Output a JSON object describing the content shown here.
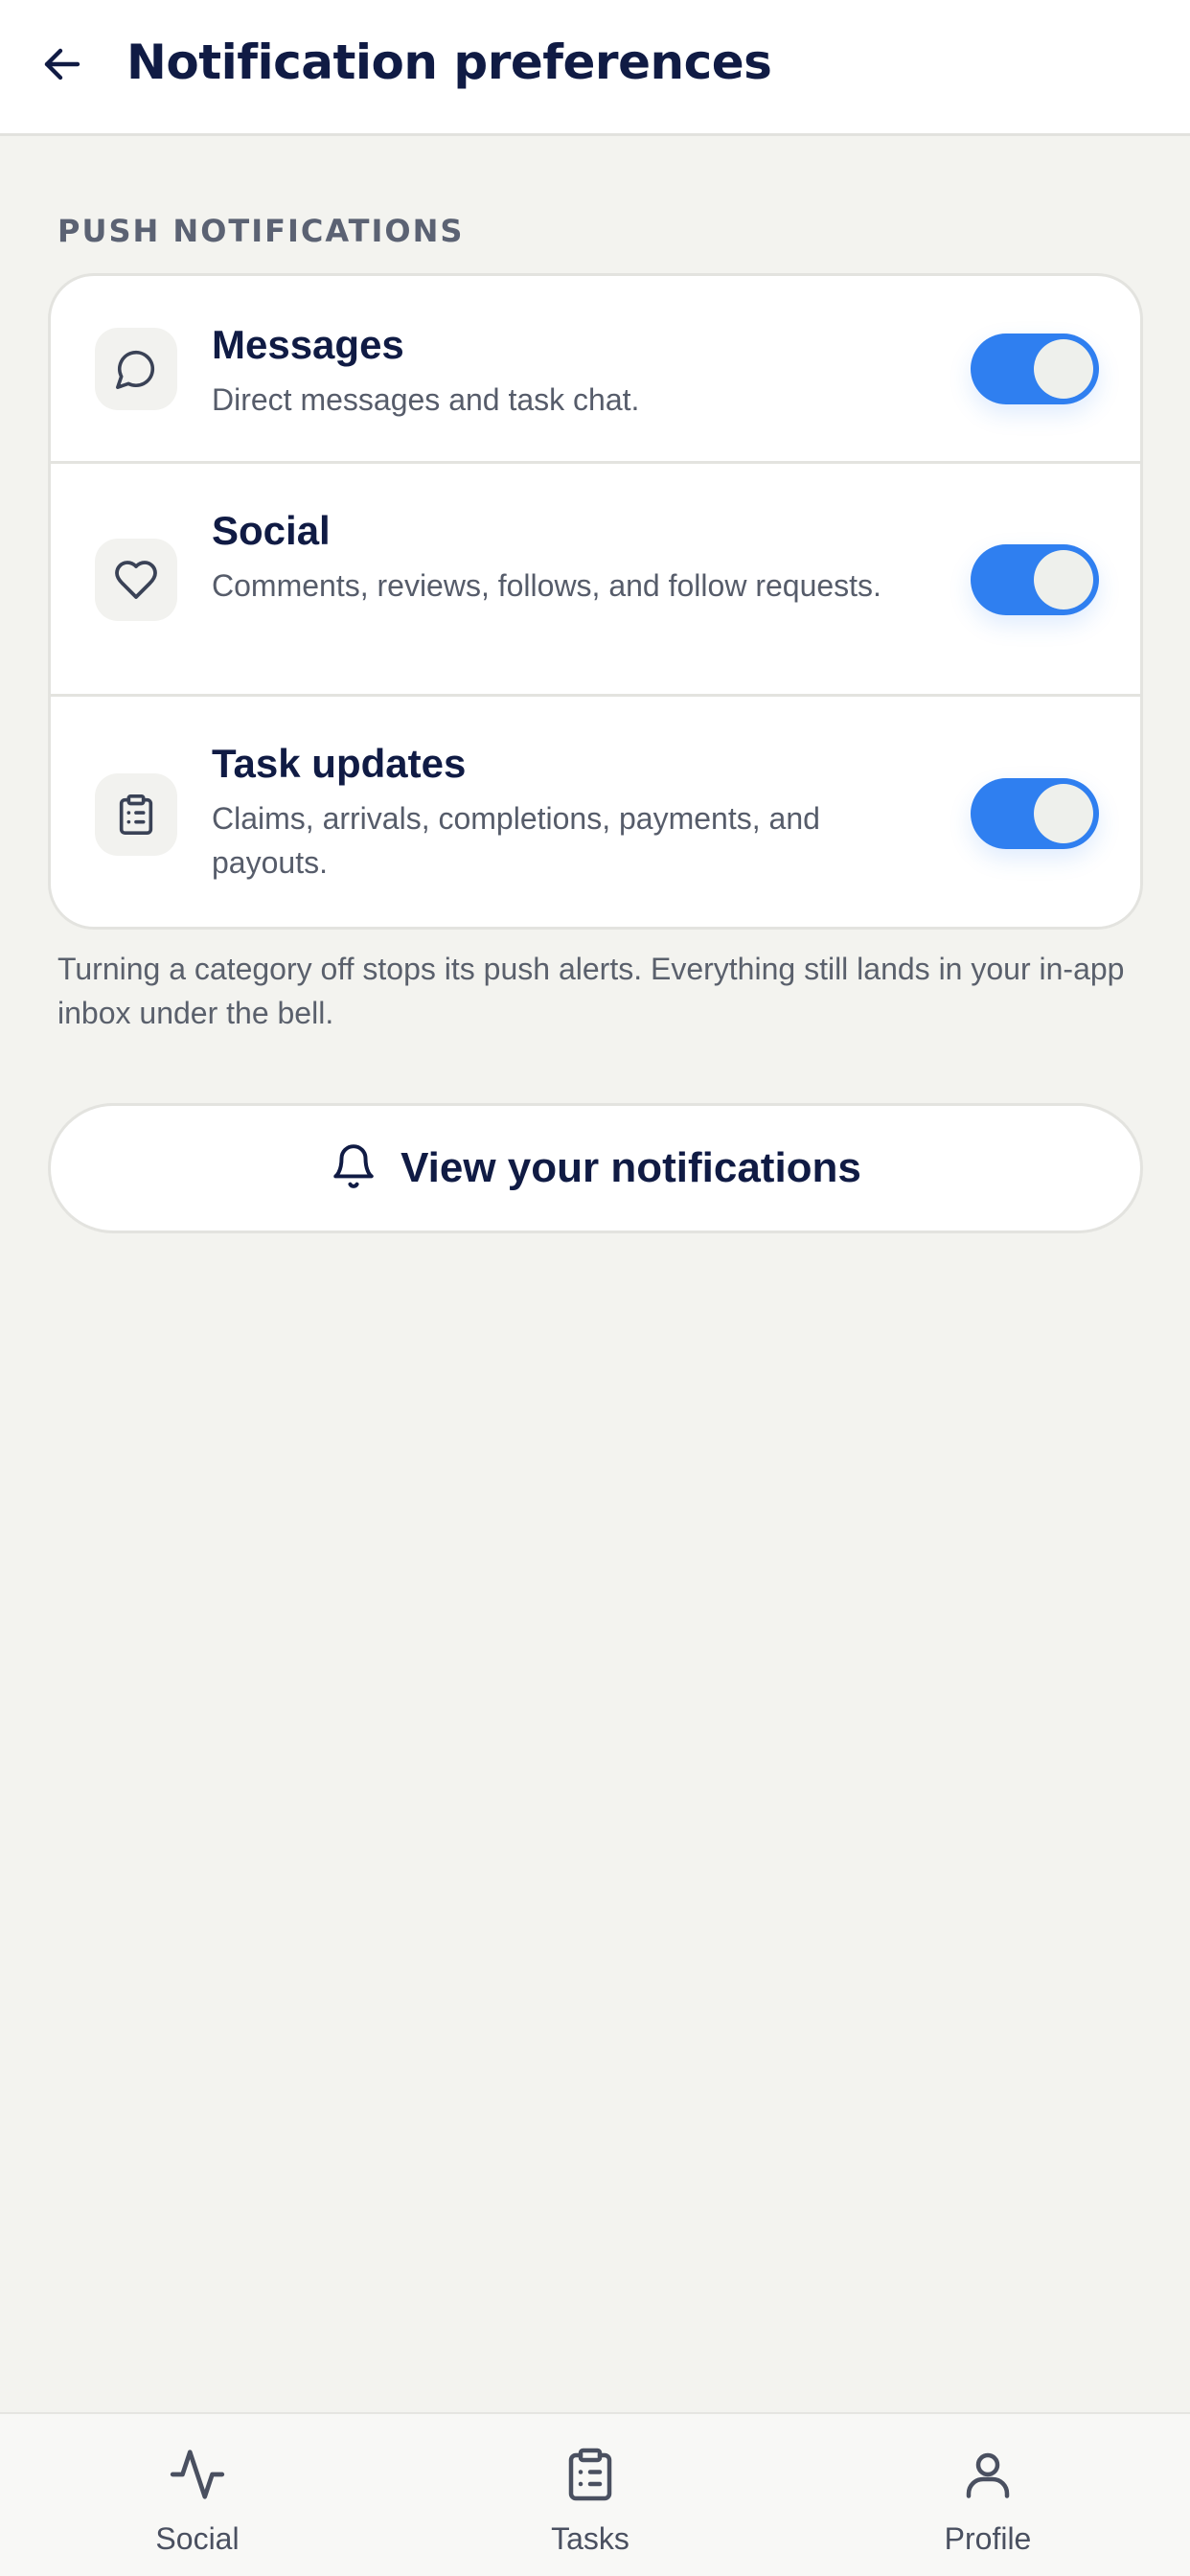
{
  "header": {
    "title": "Notification preferences"
  },
  "section": {
    "label": "PUSH NOTIFICATIONS"
  },
  "settings": [
    {
      "title": "Messages",
      "description": "Direct messages and task chat.",
      "icon": "chat-bubble-icon",
      "enabled": true
    },
    {
      "title": "Social",
      "description": "Comments, reviews, follows, and follow requests.",
      "icon": "heart-icon",
      "enabled": true
    },
    {
      "title": "Task updates",
      "description": "Claims, arrivals, completions, payments, and payouts.",
      "icon": "clipboard-icon",
      "enabled": true
    }
  ],
  "helper_text": "Turning a category off stops its push alerts. Everything still lands in your in-app inbox under the bell.",
  "view_button": {
    "label": "View your notifications",
    "icon": "bell-icon"
  },
  "bottom_nav": {
    "items": [
      {
        "label": "Social",
        "icon": "activity-pulse-icon"
      },
      {
        "label": "Tasks",
        "icon": "clipboard-icon"
      },
      {
        "label": "Profile",
        "icon": "person-icon"
      }
    ]
  },
  "colors": {
    "accent": "#2f7ff0",
    "title": "#101b44",
    "background": "#f3f3ef"
  }
}
